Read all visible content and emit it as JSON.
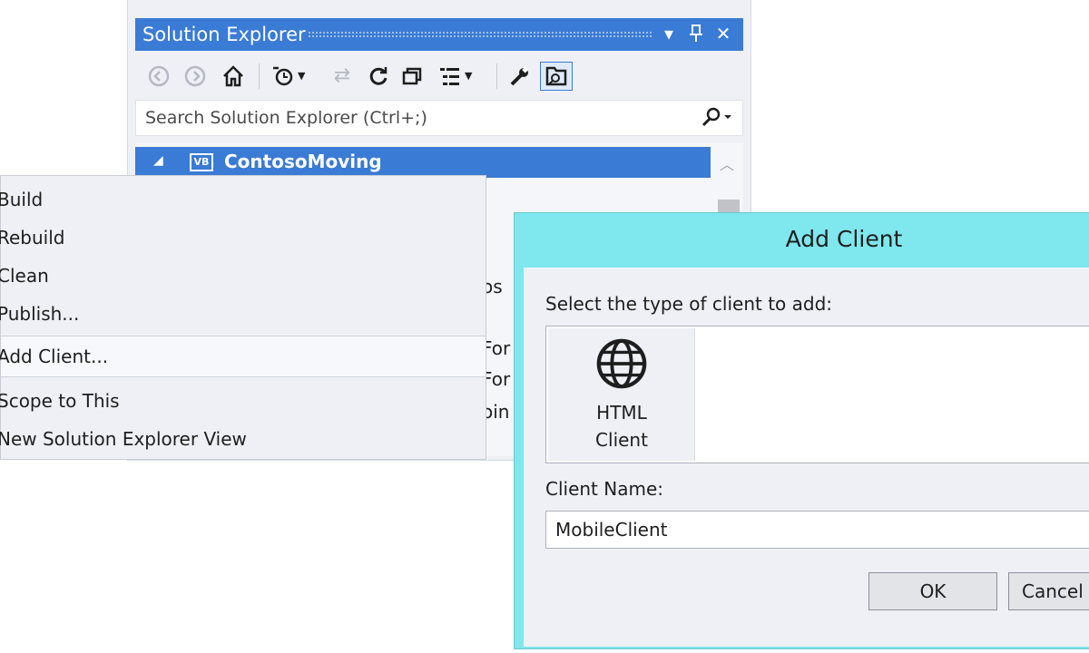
{
  "solution_explorer": {
    "title": "Solution Explorer",
    "title_controls": {
      "dropdown": "▾",
      "pin": "📌",
      "close": "✕"
    },
    "toolbar": {
      "back_icon": "back-icon",
      "forward_icon": "forward-icon",
      "home_icon": "home-icon",
      "pending_changes_icon": "pending-changes-icon",
      "sync_icon": "sync-icon",
      "refresh_icon": "refresh-icon",
      "collapse_all_icon": "collapse-all-icon",
      "properties_icon": "properties-icon",
      "wrench_icon": "wrench-icon",
      "preview_icon": "preview-selected-icon"
    },
    "search": {
      "placeholder": "Search Solution Explorer (Ctrl+;)"
    },
    "tree": {
      "project_badge": "VB",
      "project_name": "ContosoMoving",
      "partial_text": [
        "os",
        "For",
        "For",
        "oin"
      ]
    }
  },
  "context_menu": {
    "items": [
      {
        "label": "Build"
      },
      {
        "label": "Rebuild"
      },
      {
        "label": "Clean"
      },
      {
        "label": "Publish..."
      },
      {
        "label": "Add Client..."
      },
      {
        "label": "Scope to This"
      },
      {
        "label": "New Solution Explorer View"
      }
    ]
  },
  "add_client_dialog": {
    "title": "Add Client",
    "select_label": "Select the type of client to add:",
    "client_types": [
      {
        "label": "HTML Client",
        "icon": "globe-icon"
      }
    ],
    "client_name_label": "Client Name:",
    "client_name_value": "MobileClient",
    "ok_label": "OK",
    "cancel_label": "Cancel"
  },
  "colors": {
    "accent_blue": "#3a7bd5",
    "dialog_frame": "#7ee8ee",
    "panel_bg": "#eef0f6"
  }
}
